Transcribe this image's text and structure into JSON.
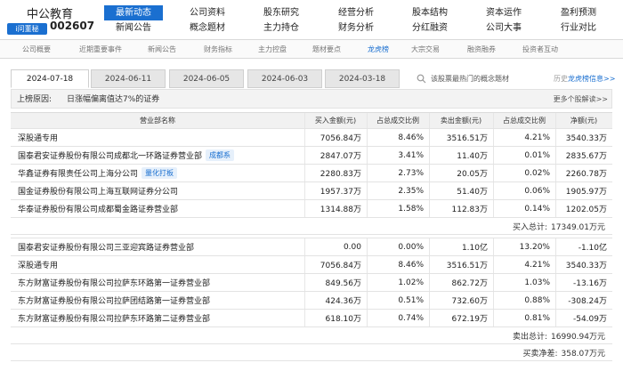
{
  "stock": {
    "name": "中公教育",
    "badge": "i问董秘",
    "code": "002607"
  },
  "nav": {
    "row1": [
      "最新动态",
      "公司资料",
      "股东研究",
      "经营分析",
      "股本结构",
      "资本运作",
      "盈利预测"
    ],
    "row2": [
      "新闻公告",
      "概念题材",
      "主力持仓",
      "财务分析",
      "分红融资",
      "公司大事",
      "行业对比"
    ],
    "active_row1": "最新动态"
  },
  "subnav": {
    "items": [
      "公司概要",
      "近期重要事件",
      "新闻公告",
      "财务指标",
      "主力控盘",
      "题材要点",
      "龙虎榜",
      "大宗交易",
      "融资融券",
      "投资者互动"
    ],
    "active": "龙虎榜"
  },
  "date_tabs": [
    "2024-07-18",
    "2024-06-11",
    "2024-06-05",
    "2024-06-03",
    "2024-03-18"
  ],
  "active_date": "2024-07-18",
  "concept_search": "该股票最热门的概念题材",
  "history": {
    "prefix": "历史",
    "link": "龙虎榜信息>>"
  },
  "reason": {
    "label": "上榜原因:",
    "value": "日涨幅偏离值达7%的证券",
    "more": "更多个股解读>>"
  },
  "table": {
    "headers": [
      "营业部名称",
      "买入金额(元)",
      "占总成交比例",
      "卖出金额(元)",
      "占总成交比例",
      "净额(元)"
    ],
    "buy_rows": [
      {
        "name": "深股通专用",
        "tag": "",
        "buy": "7056.84万",
        "buy_pct": "8.46%",
        "sell": "3516.51万",
        "sell_pct": "4.21%",
        "net": "3540.33万"
      },
      {
        "name": "国泰君安证券股份有限公司成都北一环路证券营业部",
        "tag": "成都系",
        "buy": "2847.07万",
        "buy_pct": "3.41%",
        "sell": "11.40万",
        "sell_pct": "0.01%",
        "net": "2835.67万"
      },
      {
        "name": "华鑫证券有限责任公司上海分公司",
        "tag": "量化打板",
        "buy": "2280.83万",
        "buy_pct": "2.73%",
        "sell": "20.05万",
        "sell_pct": "0.02%",
        "net": "2260.78万"
      },
      {
        "name": "国金证券股份有限公司上海互联网证券分公司",
        "tag": "",
        "buy": "1957.37万",
        "buy_pct": "2.35%",
        "sell": "51.40万",
        "sell_pct": "0.06%",
        "net": "1905.97万"
      },
      {
        "name": "华泰证券股份有限公司成都蜀金路证券营业部",
        "tag": "",
        "buy": "1314.88万",
        "buy_pct": "1.58%",
        "sell": "112.83万",
        "sell_pct": "0.14%",
        "net": "1202.05万"
      }
    ],
    "buy_total": {
      "label": "买入总计:",
      "value": "17349.01万元"
    },
    "sell_rows": [
      {
        "name": "国泰君安证券股份有限公司三亚迎宾路证券营业部",
        "tag": "",
        "buy": "0.00",
        "buy_pct": "0.00%",
        "sell": "1.10亿",
        "sell_pct": "13.20%",
        "net": "-1.10亿"
      },
      {
        "name": "深股通专用",
        "tag": "",
        "buy": "7056.84万",
        "buy_pct": "8.46%",
        "sell": "3516.51万",
        "sell_pct": "4.21%",
        "net": "3540.33万"
      },
      {
        "name": "东方财富证券股份有限公司拉萨东环路第一证券营业部",
        "tag": "",
        "buy": "849.56万",
        "buy_pct": "1.02%",
        "sell": "862.72万",
        "sell_pct": "1.03%",
        "net": "-13.16万"
      },
      {
        "name": "东方财富证券股份有限公司拉萨团结路第一证券营业部",
        "tag": "",
        "buy": "424.36万",
        "buy_pct": "0.51%",
        "sell": "732.60万",
        "sell_pct": "0.88%",
        "net": "-308.24万"
      },
      {
        "name": "东方财富证券股份有限公司拉萨东环路第二证券营业部",
        "tag": "",
        "buy": "618.10万",
        "buy_pct": "0.74%",
        "sell": "672.19万",
        "sell_pct": "0.81%",
        "net": "-54.09万"
      }
    ],
    "sell_total": {
      "label": "卖出总计:",
      "value": "16990.94万元"
    },
    "net_total": {
      "label": "买卖净差:",
      "value": "358.07万元"
    }
  },
  "colors": {
    "accent": "#1a6fd0",
    "header_bg": "#f1f1f1"
  }
}
